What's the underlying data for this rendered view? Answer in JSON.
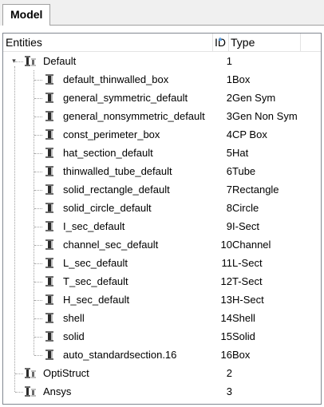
{
  "tabs": [
    {
      "label": "Model"
    }
  ],
  "columns": {
    "entities": "Entities",
    "id": "ID",
    "type": "Type"
  },
  "tree": {
    "root": {
      "label": "Default",
      "id": "1",
      "type": "",
      "expanded": true
    },
    "children": [
      {
        "label": "default_thinwalled_box",
        "id": "1",
        "type": "Box"
      },
      {
        "label": "general_symmetric_default",
        "id": "2",
        "type": "Gen Sym"
      },
      {
        "label": "general_nonsymmetric_default",
        "id": "3",
        "type": "Gen Non Sym"
      },
      {
        "label": "const_perimeter_box",
        "id": "4",
        "type": "CP Box"
      },
      {
        "label": "hat_section_default",
        "id": "5",
        "type": "Hat"
      },
      {
        "label": "thinwalled_tube_default",
        "id": "6",
        "type": "Tube"
      },
      {
        "label": "solid_rectangle_default",
        "id": "7",
        "type": "Rectangle"
      },
      {
        "label": "solid_circle_default",
        "id": "8",
        "type": "Circle"
      },
      {
        "label": "I_sec_default",
        "id": "9",
        "type": "I-Sect"
      },
      {
        "label": "channel_sec_default",
        "id": "10",
        "type": "Channel"
      },
      {
        "label": "L_sec_default",
        "id": "11",
        "type": "L-Sect"
      },
      {
        "label": "T_sec_default",
        "id": "12",
        "type": "T-Sect"
      },
      {
        "label": "H_sec_default",
        "id": "13",
        "type": "H-Sect"
      },
      {
        "label": "shell",
        "id": "14",
        "type": "Shell"
      },
      {
        "label": "solid",
        "id": "15",
        "type": "Solid"
      },
      {
        "label": "auto_standardsection.16",
        "id": "16",
        "type": "Box"
      }
    ],
    "siblings": [
      {
        "label": "OptiStruct",
        "id": "2",
        "type": "",
        "expanded": false
      },
      {
        "label": "Ansys",
        "id": "3",
        "type": "",
        "expanded": false
      }
    ]
  },
  "icons": {
    "beam_section_collector": "beam-section-collector-icon",
    "beam_section": "beam-section-icon"
  },
  "colors": {
    "icon_dark": "#2b2b2b",
    "icon_mid": "#6b6b6b",
    "icon_light": "#bdbdbd",
    "border": "#828790",
    "sort_arrow": "#569de5"
  }
}
